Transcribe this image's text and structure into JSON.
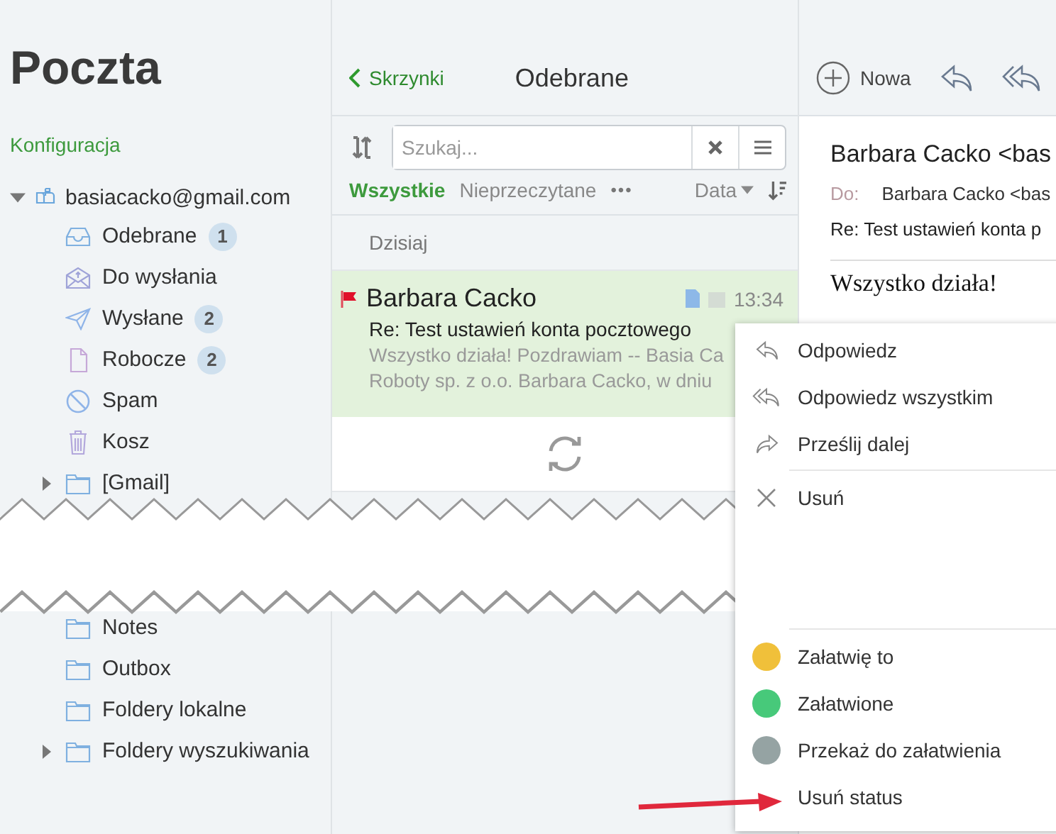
{
  "sidebar": {
    "title": "Poczta",
    "config_link": "Konfiguracja",
    "account": {
      "label": "basiacacko@gmail.com",
      "expanded": true,
      "children": [
        {
          "label": "Odebrane",
          "badge": "1"
        },
        {
          "label": "Do wysłania"
        },
        {
          "label": "Wysłane",
          "badge": "2"
        },
        {
          "label": "Robocze",
          "badge": "2"
        },
        {
          "label": "Spam"
        },
        {
          "label": "Kosz"
        },
        {
          "label": "[Gmail]",
          "expanded": false
        },
        {
          "label": "Notes"
        },
        {
          "label": "Outbox"
        },
        {
          "label": "Foldery lokalne"
        },
        {
          "label": "Foldery wyszukiwania",
          "expanded": false
        }
      ]
    }
  },
  "list": {
    "back": "Skrzynki",
    "title": "Odebrane",
    "search": {
      "placeholder": "Szukaj..."
    },
    "filters": [
      {
        "label": "Wszystkie",
        "selected": true
      },
      {
        "label": "Nieprzeczytane",
        "selected": false
      }
    ],
    "more": "•••",
    "sort": "Data",
    "group": "Dzisiaj",
    "messages": [
      {
        "sender": "Barbara Cacko",
        "time": "13:34",
        "subject": "Re: Test ustawień konta pocztowego",
        "preview": [
          "Wszystko działa! Pozdrawiam -- Basia Ca",
          "Roboty sp. z o.o. Barbara Cacko, w dniu"
        ],
        "flagged": true,
        "selected": true
      }
    ]
  },
  "reader": {
    "new_button": "Nowa",
    "from": "Barbara Cacko <bas",
    "to_label": "Do:",
    "to": "Barbara Cacko <bas",
    "subject": "Re: Test ustawień konta p",
    "body": "Wszystko działa!"
  },
  "context_menu": [
    {
      "kind": "action",
      "label": "Odpowiedz"
    },
    {
      "kind": "action",
      "label": "Odpowiedz wszystkim"
    },
    {
      "kind": "action",
      "label": "Prześlij dalej"
    },
    {
      "kind": "divider"
    },
    {
      "kind": "action",
      "label": "Usuń"
    },
    {
      "kind": "divider"
    },
    {
      "kind": "status",
      "color": "#f0c03a",
      "label": "Załatwię to"
    },
    {
      "kind": "status",
      "color": "#47c97a",
      "label": "Załatwione"
    },
    {
      "kind": "status",
      "color": "#95a3a3",
      "label": "Przekaż do załatwienia"
    },
    {
      "kind": "plain",
      "label": "Usuń status"
    }
  ]
}
